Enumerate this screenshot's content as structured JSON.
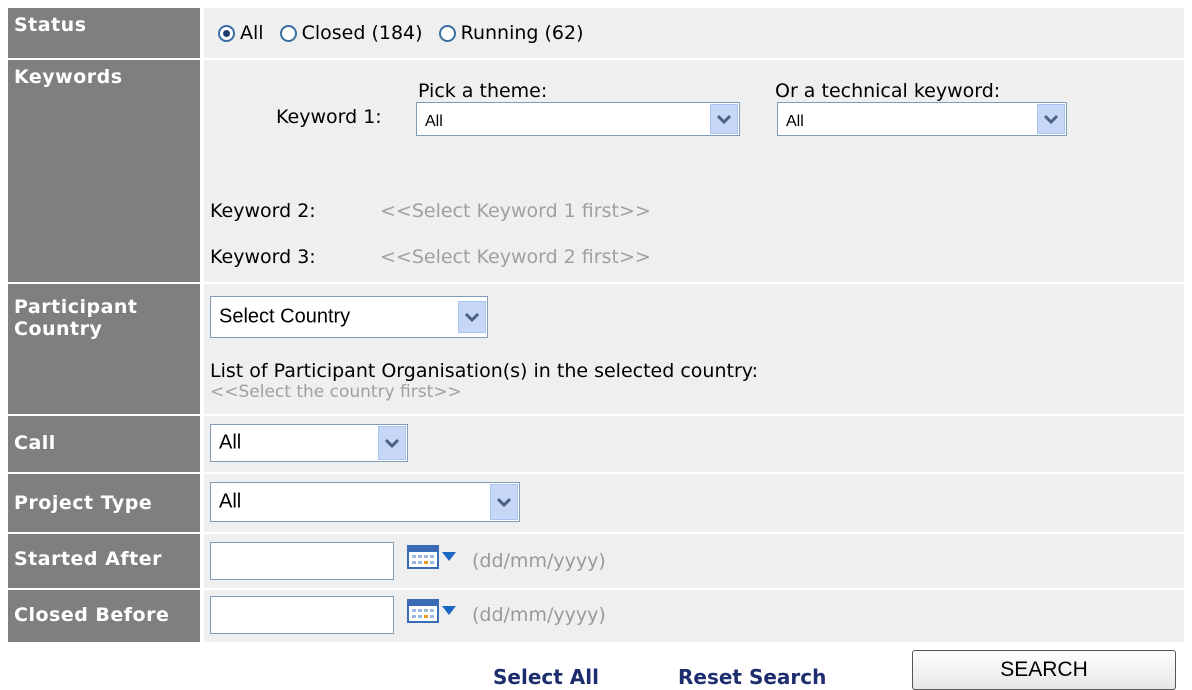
{
  "status": {
    "label": "Status",
    "options": [
      {
        "label": "All",
        "selected": true
      },
      {
        "label": "Closed (184)",
        "selected": false
      },
      {
        "label": "Running (62)",
        "selected": false
      }
    ]
  },
  "keywords": {
    "label": "Keywords",
    "keyword1_label": "Keyword 1:",
    "theme_caption": "Pick a theme:",
    "theme_value": "All",
    "technical_caption": "Or a technical keyword:",
    "technical_value": "All",
    "keyword2_label": "Keyword 2:",
    "keyword2_hint": "<<Select Keyword 1 first>>",
    "keyword3_label": "Keyword 3:",
    "keyword3_hint": "<<Select Keyword 2 first>>"
  },
  "participant": {
    "label_line1": "Participant",
    "label_line2": "Country",
    "country_value": "Select Country",
    "org_list_caption": "List of Participant Organisation(s) in the selected country:",
    "org_hint": "<<Select the country first>>"
  },
  "call": {
    "label": "Call",
    "value": "All"
  },
  "project_type": {
    "label": "Project Type",
    "value": "All"
  },
  "started_after": {
    "label": "Started After",
    "value": "",
    "format_hint": "(dd/mm/yyyy)"
  },
  "closed_before": {
    "label": "Closed Before",
    "value": "",
    "format_hint": "(dd/mm/yyyy)"
  },
  "actions": {
    "select_all": "Select All",
    "reset_search": "Reset Search",
    "search": "SEARCH"
  },
  "colors": {
    "label_bg": "#7f7f7f",
    "value_bg": "#efefef",
    "link": "#1c2e6e",
    "hint": "#a0a0a0"
  },
  "icons": [
    "radio-selected-icon",
    "radio-icon",
    "chevron-down-icon",
    "calendar-icon"
  ]
}
